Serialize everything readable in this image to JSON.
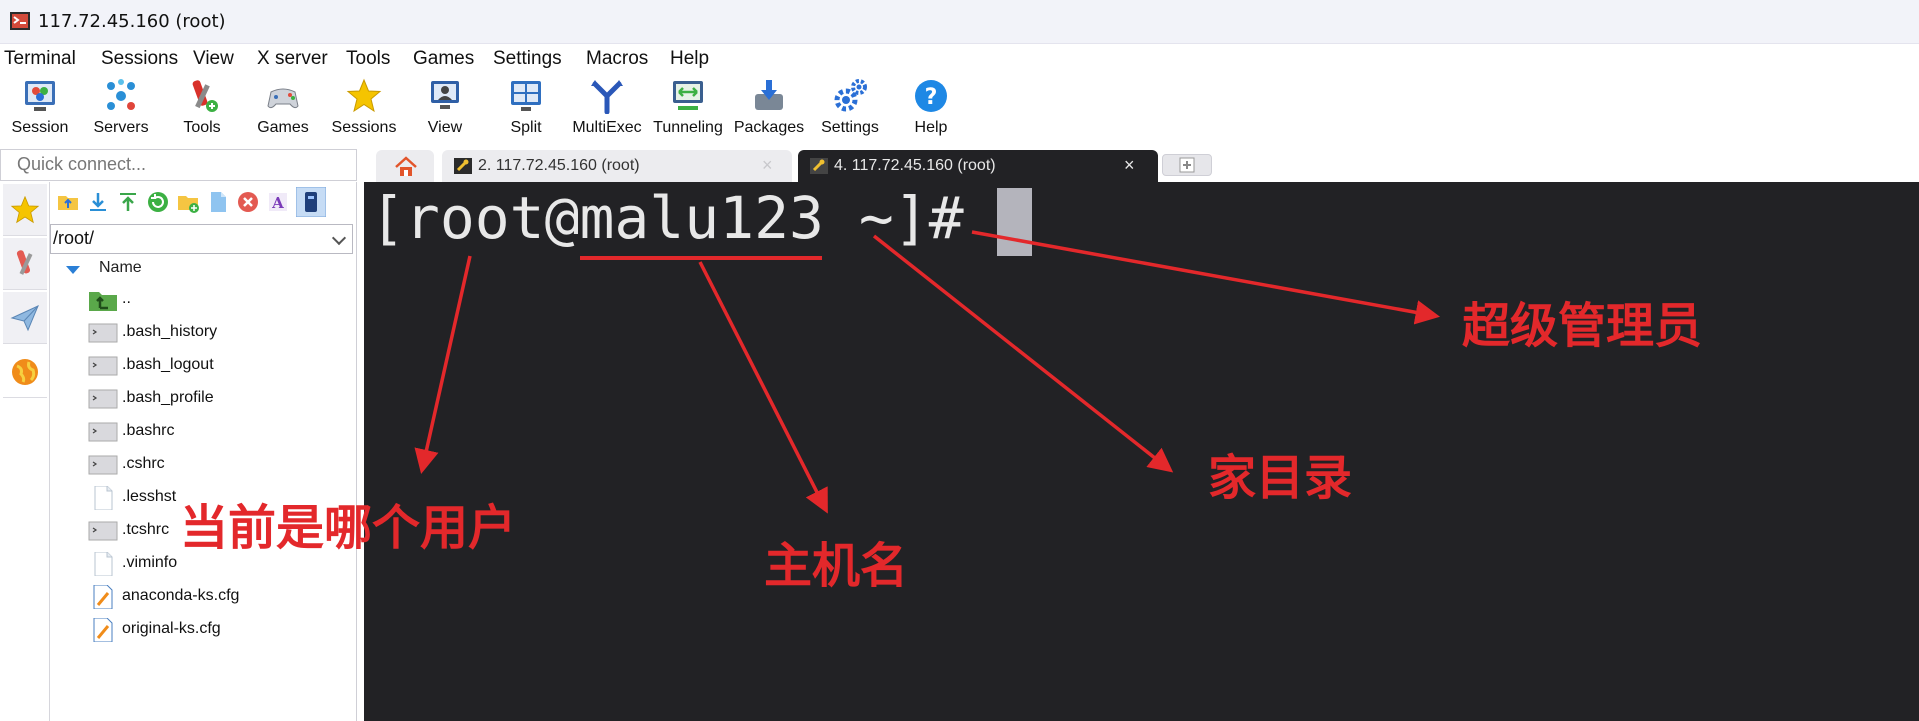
{
  "window": {
    "title": "117.72.45.160 (root)"
  },
  "menu": [
    "Terminal",
    "Sessions",
    "View",
    "X server",
    "Tools",
    "Games",
    "Settings",
    "Macros",
    "Help"
  ],
  "toolbar": [
    {
      "label": "Session",
      "icon": "session-icon"
    },
    {
      "label": "Servers",
      "icon": "servers-icon"
    },
    {
      "label": "Tools",
      "icon": "tools-icon"
    },
    {
      "label": "Games",
      "icon": "games-icon"
    },
    {
      "label": "Sessions",
      "icon": "star-icon"
    },
    {
      "label": "View",
      "icon": "view-icon"
    },
    {
      "label": "Split",
      "icon": "split-icon"
    },
    {
      "label": "MultiExec",
      "icon": "multiexec-icon"
    },
    {
      "label": "Tunneling",
      "icon": "tunneling-icon"
    },
    {
      "label": "Packages",
      "icon": "packages-icon"
    },
    {
      "label": "Settings",
      "icon": "settings-icon"
    },
    {
      "label": "Help",
      "icon": "help-icon"
    }
  ],
  "quick_connect": {
    "placeholder": "Quick connect..."
  },
  "tabs": [
    {
      "label": "2. 117.72.45.160 (root)",
      "close": "×",
      "active": false
    },
    {
      "label": "4. 117.72.45.160 (root)",
      "close": "×",
      "active": true
    }
  ],
  "sftp": {
    "path": "/root/",
    "column": "Name",
    "files": [
      "..",
      ".bash_history",
      ".bash_logout",
      ".bash_profile",
      ".bashrc",
      ".cshrc",
      ".lesshst",
      ".tcshrc",
      ".viminfo",
      "anaconda-ks.cfg",
      "original-ks.cfg"
    ]
  },
  "terminal": {
    "prompt": "[root@malu123 ~]# "
  },
  "annotations": {
    "user": "当前是哪个用户",
    "hostname": "主机名",
    "home": "家目录",
    "root": "超级管理员",
    "color": "#e3282b"
  },
  "colors": {
    "terminal_bg": "#222225",
    "accent": "#2a7fd6"
  }
}
